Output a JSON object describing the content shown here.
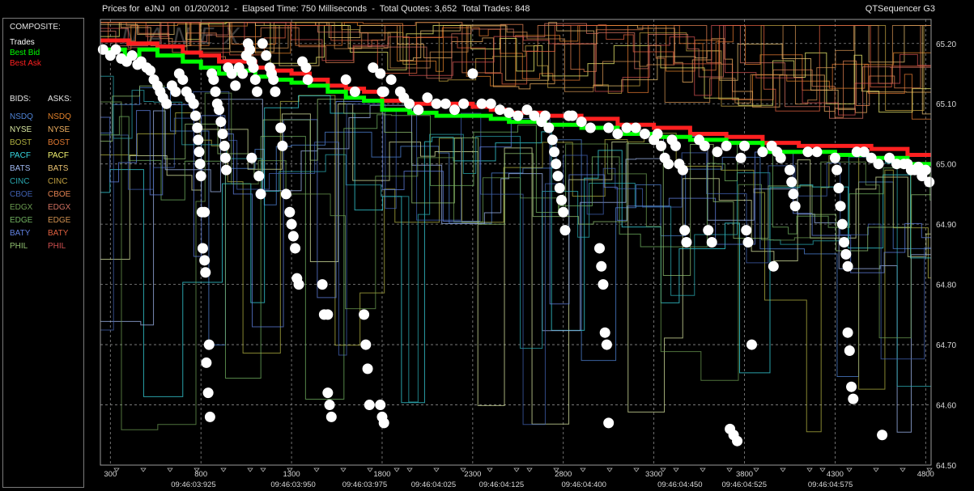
{
  "header": {
    "title": "Prices for  eJNJ  on  01/20/2012  -  Elapsed Time: 750 Milliseconds  -  Total Quotes: 3,652  Total Trades: 848",
    "app": "QTSequencer G3"
  },
  "legend": {
    "composite_label": "COMPOSITE:",
    "trades": "Trades",
    "best_bid": "Best Bid",
    "best_ask": "Best Ask",
    "bids_label": "BIDS:",
    "asks_label": "ASKS:",
    "exchanges": [
      {
        "name": "NSDQ",
        "bid_color": "#4f83d6",
        "ask_color": "#e0802a"
      },
      {
        "name": "NYSE",
        "bid_color": "#d8e6a0",
        "ask_color": "#f0b060"
      },
      {
        "name": "BOST",
        "bid_color": "#b0b040",
        "ask_color": "#e07830"
      },
      {
        "name": "PACF",
        "bid_color": "#37d6e0",
        "ask_color": "#f0f070"
      },
      {
        "name": "BATS",
        "bid_color": "#a0b8f0",
        "ask_color": "#e8c070"
      },
      {
        "name": "CINC",
        "bid_color": "#2aa8b0",
        "ask_color": "#c0a040"
      },
      {
        "name": "CBOE",
        "bid_color": "#4060b0",
        "ask_color": "#e08050"
      },
      {
        "name": "EDGX",
        "bid_color": "#6a9a50",
        "ask_color": "#d07060"
      },
      {
        "name": "EDGE",
        "bid_color": "#70b060",
        "ask_color": "#d09050"
      },
      {
        "name": "BATY",
        "bid_color": "#6080e0",
        "ask_color": "#e06040"
      },
      {
        "name": "PHIL",
        "bid_color": "#90c070",
        "ask_color": "#d05050"
      }
    ]
  },
  "colors": {
    "trade": "#ffffff",
    "best_bid": "#00ff00",
    "best_ask": "#ff2020",
    "grid": "#8a8a8a",
    "watermark": "#3a3a3a"
  },
  "watermark": "NANEX",
  "chart_data": {
    "type": "scatter",
    "title": "",
    "xlabel": "",
    "ylabel": "",
    "xlim": [
      245,
      4830
    ],
    "ylim": [
      64.5,
      65.24
    ],
    "y_ticks": [
      "65.20",
      "65.10",
      "65.00",
      "64.90",
      "64.80",
      "64.70",
      "64.60",
      "64.50"
    ],
    "x_ticks": [
      "300",
      "800",
      "1300",
      "1800",
      "2300",
      "2800",
      "3300",
      "3800",
      "4300",
      "4800"
    ],
    "x_ticks_values": [
      300,
      800,
      1300,
      1800,
      2300,
      2800,
      3300,
      3800,
      4300,
      4800
    ],
    "time_labels": [
      {
        "x": 245,
        "label": "09:46:03:925"
      },
      {
        "x": 795,
        "label": "09:46:03:950"
      },
      {
        "x": 1190,
        "label": "09:46:03:975"
      },
      {
        "x": 1570,
        "label": "09:46:04:025"
      },
      {
        "x": 1945,
        "label": "09:46:04:125"
      },
      {
        "x": 2400,
        "label": "09:46:04:400"
      },
      {
        "x": 2930,
        "label": "09:46:04:450"
      },
      {
        "x": 3285,
        "label": "09:46:04:525"
      },
      {
        "x": 3760,
        "label": "09:46:04:575"
      }
    ],
    "best_bid": [
      [
        245,
        65.19
      ],
      [
        380,
        65.18
      ],
      [
        460,
        65.19
      ],
      [
        560,
        65.18
      ],
      [
        700,
        65.17
      ],
      [
        800,
        65.16
      ],
      [
        900,
        65.15
      ],
      [
        1000,
        65.155
      ],
      [
        1100,
        65.145
      ],
      [
        1200,
        65.14
      ],
      [
        1300,
        65.135
      ],
      [
        1400,
        65.13
      ],
      [
        1500,
        65.12
      ],
      [
        1600,
        65.11
      ],
      [
        1700,
        65.105
      ],
      [
        1800,
        65.09
      ],
      [
        1950,
        65.085
      ],
      [
        2100,
        65.08
      ],
      [
        2300,
        65.08
      ],
      [
        2400,
        65.075
      ],
      [
        2500,
        65.07
      ],
      [
        2700,
        65.065
      ],
      [
        2900,
        65.06
      ],
      [
        3100,
        65.05
      ],
      [
        3300,
        65.045
      ],
      [
        3500,
        65.04
      ],
      [
        3700,
        65.035
      ],
      [
        3900,
        65.02
      ],
      [
        4100,
        65.02
      ],
      [
        4300,
        65.015
      ],
      [
        4500,
        65.01
      ],
      [
        4700,
        65.0
      ],
      [
        4830,
        65.0
      ]
    ],
    "best_ask": [
      [
        245,
        65.205
      ],
      [
        400,
        65.2
      ],
      [
        560,
        65.195
      ],
      [
        700,
        65.185
      ],
      [
        800,
        65.18
      ],
      [
        900,
        65.17
      ],
      [
        1000,
        65.17
      ],
      [
        1100,
        65.16
      ],
      [
        1200,
        65.155
      ],
      [
        1300,
        65.15
      ],
      [
        1400,
        65.14
      ],
      [
        1500,
        65.13
      ],
      [
        1600,
        65.125
      ],
      [
        1700,
        65.12
      ],
      [
        1800,
        65.105
      ],
      [
        1950,
        65.1
      ],
      [
        2100,
        65.1
      ],
      [
        2300,
        65.095
      ],
      [
        2400,
        65.09
      ],
      [
        2500,
        65.085
      ],
      [
        2700,
        65.08
      ],
      [
        2900,
        65.075
      ],
      [
        3100,
        65.065
      ],
      [
        3300,
        65.06
      ],
      [
        3500,
        65.05
      ],
      [
        3700,
        65.045
      ],
      [
        3900,
        65.035
      ],
      [
        4100,
        65.03
      ],
      [
        4300,
        65.03
      ],
      [
        4500,
        65.025
      ],
      [
        4700,
        65.015
      ],
      [
        4830,
        65.015
      ]
    ],
    "trades": [
      [
        260,
        65.19
      ],
      [
        300,
        65.18
      ],
      [
        330,
        65.19
      ],
      [
        360,
        65.175
      ],
      [
        390,
        65.17
      ],
      [
        420,
        65.18
      ],
      [
        450,
        65.165
      ],
      [
        470,
        65.17
      ],
      [
        500,
        65.16
      ],
      [
        520,
        65.155
      ],
      [
        540,
        65.14
      ],
      [
        560,
        65.13
      ],
      [
        575,
        65.12
      ],
      [
        590,
        65.11
      ],
      [
        610,
        65.1
      ],
      [
        640,
        65.13
      ],
      [
        660,
        65.12
      ],
      [
        680,
        65.15
      ],
      [
        700,
        65.14
      ],
      [
        720,
        65.12
      ],
      [
        740,
        65.11
      ],
      [
        760,
        65.1
      ],
      [
        770,
        65.08
      ],
      [
        780,
        65.06
      ],
      [
        785,
        65.04
      ],
      [
        790,
        65.02
      ],
      [
        795,
        65.0
      ],
      [
        800,
        64.98
      ],
      [
        805,
        64.92
      ],
      [
        820,
        64.92
      ],
      [
        810,
        64.86
      ],
      [
        820,
        64.84
      ],
      [
        825,
        64.82
      ],
      [
        830,
        64.67
      ],
      [
        840,
        64.62
      ],
      [
        850,
        64.58
      ],
      [
        845,
        64.7
      ],
      [
        860,
        65.15
      ],
      [
        870,
        65.14
      ],
      [
        880,
        65.12
      ],
      [
        890,
        65.1
      ],
      [
        900,
        65.09
      ],
      [
        910,
        65.07
      ],
      [
        920,
        65.05
      ],
      [
        930,
        65.03
      ],
      [
        935,
        65.01
      ],
      [
        940,
        64.99
      ],
      [
        950,
        65.16
      ],
      [
        970,
        65.15
      ],
      [
        990,
        65.13
      ],
      [
        1010,
        65.16
      ],
      [
        1030,
        65.15
      ],
      [
        1050,
        65.18
      ],
      [
        1060,
        65.2
      ],
      [
        1070,
        65.19
      ],
      [
        1080,
        65.17
      ],
      [
        1090,
        65.16
      ],
      [
        1100,
        65.14
      ],
      [
        1110,
        65.12
      ],
      [
        1080,
        65.01
      ],
      [
        1120,
        64.98
      ],
      [
        1130,
        64.95
      ],
      [
        1140,
        65.2
      ],
      [
        1160,
        65.18
      ],
      [
        1180,
        65.16
      ],
      [
        1190,
        65.15
      ],
      [
        1200,
        65.14
      ],
      [
        1210,
        65.12
      ],
      [
        1240,
        65.06
      ],
      [
        1250,
        65.03
      ],
      [
        1270,
        64.95
      ],
      [
        1290,
        64.92
      ],
      [
        1300,
        64.9
      ],
      [
        1310,
        64.88
      ],
      [
        1320,
        64.86
      ],
      [
        1330,
        64.81
      ],
      [
        1340,
        64.8
      ],
      [
        1360,
        65.17
      ],
      [
        1380,
        65.16
      ],
      [
        1390,
        65.14
      ],
      [
        1470,
        64.8
      ],
      [
        1480,
        64.75
      ],
      [
        1500,
        64.75
      ],
      [
        1500,
        64.62
      ],
      [
        1510,
        64.6
      ],
      [
        1520,
        64.58
      ],
      [
        1600,
        65.14
      ],
      [
        1650,
        65.12
      ],
      [
        1700,
        64.75
      ],
      [
        1710,
        64.7
      ],
      [
        1720,
        64.66
      ],
      [
        1730,
        64.6
      ],
      [
        1750,
        65.16
      ],
      [
        1790,
        65.15
      ],
      [
        1800,
        65.12
      ],
      [
        1810,
        65.12
      ],
      [
        1790,
        64.6
      ],
      [
        1800,
        64.58
      ],
      [
        1810,
        64.57
      ],
      [
        1850,
        65.14
      ],
      [
        1900,
        65.12
      ],
      [
        1920,
        65.11
      ],
      [
        1950,
        65.1
      ],
      [
        2000,
        65.09
      ],
      [
        2050,
        65.11
      ],
      [
        2100,
        65.1
      ],
      [
        2150,
        65.1
      ],
      [
        2200,
        65.09
      ],
      [
        2250,
        65.1
      ],
      [
        2300,
        65.15
      ],
      [
        2350,
        65.1
      ],
      [
        2400,
        65.1
      ],
      [
        2450,
        65.09
      ],
      [
        2500,
        65.085
      ],
      [
        2550,
        65.08
      ],
      [
        2600,
        65.09
      ],
      [
        2640,
        65.08
      ],
      [
        2680,
        65.07
      ],
      [
        2700,
        65.08
      ],
      [
        2720,
        65.06
      ],
      [
        2740,
        65.04
      ],
      [
        2750,
        65.02
      ],
      [
        2760,
        65.0
      ],
      [
        2770,
        64.98
      ],
      [
        2780,
        64.96
      ],
      [
        2790,
        64.94
      ],
      [
        2800,
        64.92
      ],
      [
        2810,
        64.89
      ],
      [
        2830,
        65.08
      ],
      [
        2850,
        65.08
      ],
      [
        2900,
        65.07
      ],
      [
        2950,
        65.06
      ],
      [
        3000,
        64.86
      ],
      [
        3010,
        64.83
      ],
      [
        3020,
        64.8
      ],
      [
        3030,
        64.72
      ],
      [
        3040,
        64.7
      ],
      [
        3050,
        64.57
      ],
      [
        3050,
        65.06
      ],
      [
        3100,
        65.05
      ],
      [
        3150,
        65.06
      ],
      [
        3200,
        65.06
      ],
      [
        3250,
        65.05
      ],
      [
        3300,
        65.04
      ],
      [
        3320,
        65.05
      ],
      [
        3340,
        65.03
      ],
      [
        3360,
        65.01
      ],
      [
        3380,
        65.0
      ],
      [
        3400,
        65.04
      ],
      [
        3420,
        65.03
      ],
      [
        3440,
        65.0
      ],
      [
        3460,
        64.99
      ],
      [
        3470,
        64.89
      ],
      [
        3480,
        64.87
      ],
      [
        3550,
        65.04
      ],
      [
        3580,
        65.03
      ],
      [
        3600,
        64.89
      ],
      [
        3620,
        64.87
      ],
      [
        3650,
        65.02
      ],
      [
        3700,
        65.03
      ],
      [
        3720,
        64.56
      ],
      [
        3740,
        64.55
      ],
      [
        3760,
        64.54
      ],
      [
        3780,
        65.01
      ],
      [
        3800,
        65.03
      ],
      [
        3810,
        64.89
      ],
      [
        3820,
        64.87
      ],
      [
        3840,
        64.7
      ],
      [
        3900,
        65.02
      ],
      [
        3950,
        65.03
      ],
      [
        3960,
        64.83
      ],
      [
        3980,
        65.02
      ],
      [
        4000,
        65.01
      ],
      [
        4050,
        64.99
      ],
      [
        4060,
        64.97
      ],
      [
        4070,
        64.95
      ],
      [
        4080,
        64.93
      ],
      [
        4150,
        65.02
      ],
      [
        4200,
        65.02
      ],
      [
        4300,
        65.01
      ],
      [
        4310,
        64.99
      ],
      [
        4320,
        64.96
      ],
      [
        4330,
        64.93
      ],
      [
        4340,
        64.9
      ],
      [
        4350,
        64.87
      ],
      [
        4360,
        64.85
      ],
      [
        4370,
        64.83
      ],
      [
        4370,
        64.72
      ],
      [
        4380,
        64.69
      ],
      [
        4390,
        64.63
      ],
      [
        4400,
        64.61
      ],
      [
        4420,
        65.02
      ],
      [
        4460,
        65.02
      ],
      [
        4500,
        65.01
      ],
      [
        4540,
        65.0
      ],
      [
        4560,
        64.55
      ],
      [
        4600,
        65.01
      ],
      [
        4640,
        65.0
      ],
      [
        4680,
        65.0
      ],
      [
        4700,
        65.0
      ],
      [
        4720,
        64.99
      ],
      [
        4740,
        64.99
      ],
      [
        4760,
        64.995
      ],
      [
        4780,
        64.98
      ],
      [
        4800,
        64.99
      ],
      [
        4820,
        64.97
      ]
    ]
  }
}
